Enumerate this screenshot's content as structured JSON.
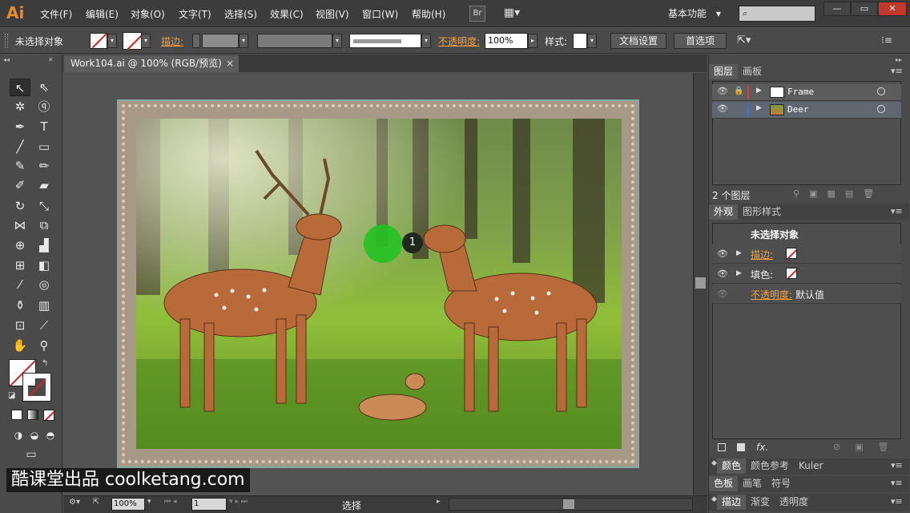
{
  "app": {
    "logo": "Ai"
  },
  "menu": [
    "文件(F)",
    "编辑(E)",
    "对象(O)",
    "文字(T)",
    "选择(S)",
    "效果(C)",
    "视图(V)",
    "窗口(W)",
    "帮助(H)"
  ],
  "toolbar_icons": {
    "bridge": "Br",
    "arrange": "▦▾"
  },
  "workspace": {
    "label": "基本功能",
    "arrow": "▾"
  },
  "search": {
    "icon": "⌕"
  },
  "window_controls": {
    "minimize": "—",
    "restore": "▭",
    "close": "✕"
  },
  "control_bar": {
    "selection": "未选择对象",
    "stroke_label": "描边:",
    "opacity_label": "不透明度:",
    "opacity_value": "100%",
    "style_label": "样式:",
    "doc_settings": "文档设置",
    "preferences": "首选项"
  },
  "document_tab": {
    "title": "Work104.ai @ 100% (RGB/预览)",
    "close": "×"
  },
  "canvas": {
    "cursor_marker": "1",
    "colors": {
      "frame": "#a89886",
      "frame_border": "#7fa8a8",
      "cursor_green": "#22c224"
    }
  },
  "status_bar": {
    "zoom": "100%",
    "artboard": "1",
    "mode": "选择"
  },
  "layers_panel": {
    "tabs": [
      "图层",
      "画板"
    ],
    "layers": [
      {
        "name": "Frame",
        "color": "#e23b3b",
        "locked": true
      },
      {
        "name": "Deer",
        "color": "#3b6fe2",
        "locked": false
      }
    ],
    "count": "2 个图层"
  },
  "appearance_panel": {
    "tabs": [
      "外观",
      "图形样式"
    ],
    "title": "未选择对象",
    "rows": [
      {
        "label": "描边:",
        "link": true
      },
      {
        "label": "填色:",
        "link": false
      }
    ],
    "opacity_label": "不透明度:",
    "opacity_value": "默认值",
    "fx": "fx."
  },
  "color_panel": {
    "tabs": [
      "颜色",
      "颜色参考",
      "Kuler"
    ]
  },
  "swatch_panel": {
    "tabs": [
      "色板",
      "画笔",
      "符号"
    ]
  },
  "stroke_panel": {
    "tabs": [
      "描边",
      "渐变",
      "透明度"
    ]
  },
  "watermark": "酷课堂出品 coolketang.com"
}
